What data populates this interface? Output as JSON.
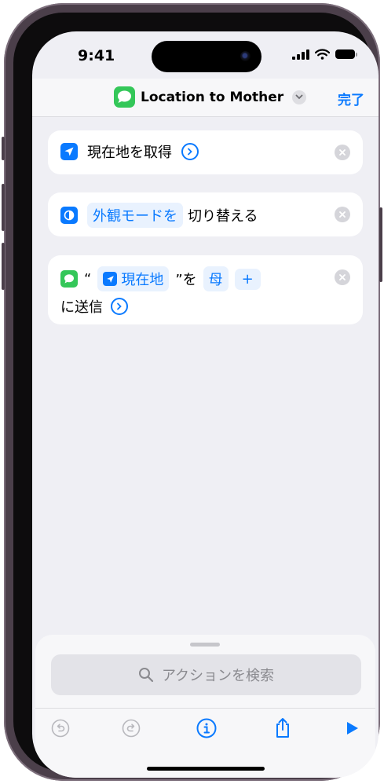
{
  "status": {
    "time": "9:41"
  },
  "nav": {
    "title": "Location to Mother",
    "done": "完了"
  },
  "actions": [
    {
      "text": "現在地を取得"
    },
    {
      "token": "外観モードを",
      "text": "切り替える"
    },
    {
      "open_quote": "“",
      "token": "現在地",
      "close_quote": "”を",
      "recipient": "母",
      "add": "+",
      "text": "に送信"
    }
  ],
  "search": {
    "placeholder": "アクションを検索"
  },
  "icons": {
    "app": "messages-icon",
    "get_location": "location-arrow-icon",
    "appearance": "appearance-toggle-icon",
    "send": "messages-icon",
    "toolbar": [
      "undo-icon",
      "redo-icon",
      "info-icon",
      "share-icon",
      "play-icon"
    ]
  },
  "colors": {
    "accent": "#0a7aff",
    "messages": "#34c759"
  }
}
